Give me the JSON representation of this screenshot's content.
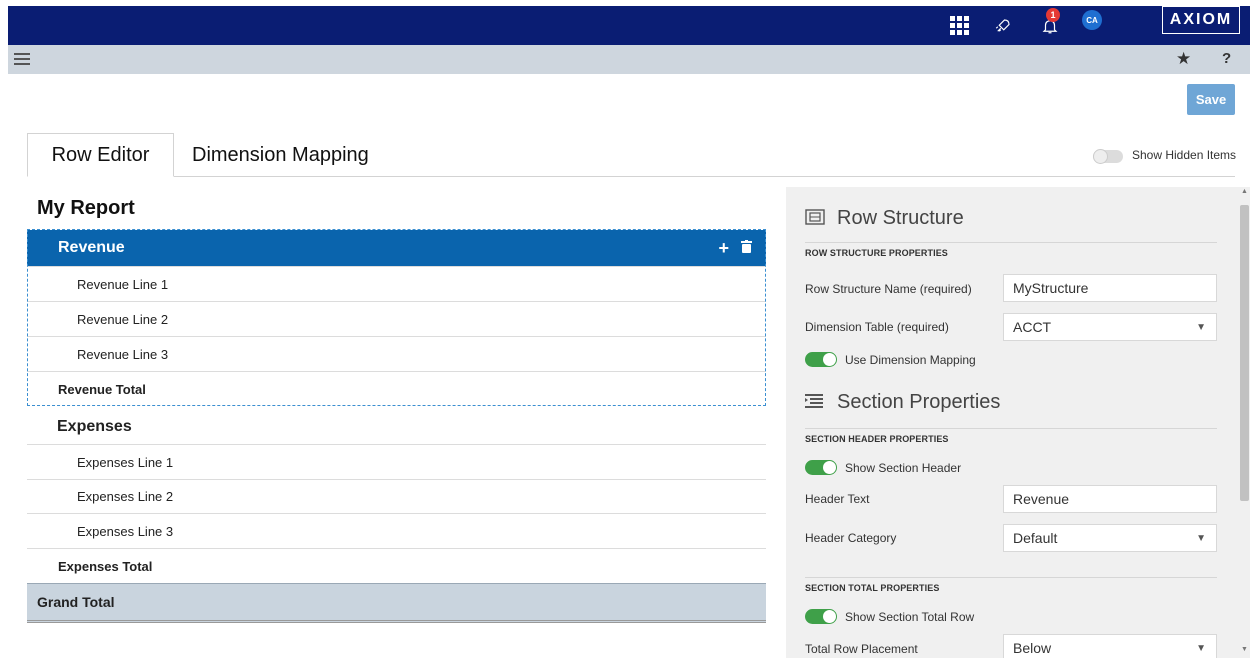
{
  "topbar": {
    "notification_count": "1",
    "avatar_initials": "CA",
    "logo_text": "AXIOM",
    "icons": [
      "apps-grid-icon",
      "rocket-icon",
      "bell-icon"
    ],
    "background_color": "#0a1d73"
  },
  "subbar": {
    "icons": [
      "hamburger-icon",
      "star-icon",
      "help-icon"
    ],
    "help_glyph": "?",
    "star_glyph": "★"
  },
  "toolbar": {
    "save_label": "Save"
  },
  "tabs": [
    {
      "label": "Row Editor",
      "active": true
    },
    {
      "label": "Dimension Mapping",
      "active": false
    }
  ],
  "show_hidden": {
    "label": "Show Hidden Items",
    "enabled": false
  },
  "report": {
    "title": "My Report",
    "sections": [
      {
        "header": "Revenue",
        "selected": true,
        "lines": [
          "Revenue Line 1",
          "Revenue Line 2",
          "Revenue Line 3"
        ],
        "total": "Revenue Total"
      },
      {
        "header": "Expenses",
        "selected": false,
        "lines": [
          "Expenses Line 1",
          "Expenses Line 2",
          "Expenses Line 3"
        ],
        "total": "Expenses Total"
      }
    ],
    "grand_total": "Grand Total",
    "row_actions": {
      "add_glyph": "+",
      "delete_glyph": "🗑"
    }
  },
  "panel": {
    "row_structure": {
      "heading": "Row Structure",
      "subheading": "ROW STRUCTURE PROPERTIES",
      "name_label": "Row Structure Name (required)",
      "name_value": "MyStructure",
      "table_label": "Dimension Table (required)",
      "table_value": "ACCT",
      "mapping_toggle_label": "Use Dimension Mapping",
      "mapping_enabled": true
    },
    "section_properties": {
      "heading": "Section Properties",
      "header_subheading": "SECTION HEADER PROPERTIES",
      "show_header_label": "Show Section Header",
      "show_header_enabled": true,
      "header_text_label": "Header Text",
      "header_text_value": "Revenue",
      "header_category_label": "Header Category",
      "header_category_value": "Default",
      "total_subheading": "SECTION TOTAL PROPERTIES",
      "show_total_label": "Show Section Total Row",
      "show_total_enabled": true,
      "placement_label": "Total Row Placement",
      "placement_value": "Below"
    }
  },
  "colors": {
    "accent": "#0a64ad",
    "toggle_on": "#3fa049",
    "save_button": "#6fa6d6",
    "grand_total_bg": "#c9d4de"
  }
}
